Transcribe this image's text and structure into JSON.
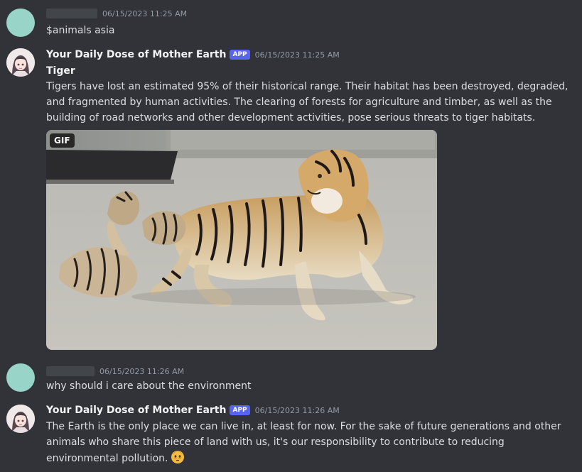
{
  "messages": [
    {
      "timestamp": "06/15/2023 11:25 AM",
      "text": "$animals asia"
    },
    {
      "username": "Your Daily Dose of Mother Earth",
      "badge": "APP",
      "timestamp": "06/15/2023 11:25 AM",
      "title": "Tiger",
      "text": "Tigers have lost an estimated 95% of their historical range. Their habitat has been destroyed, degraded, and fragmented by human activities. The clearing of forests for agriculture and timber, as well as the building of road networks and other development activities, pose serious threats to tiger habitats.",
      "attachment": {
        "badge": "GIF"
      }
    },
    {
      "timestamp": "06/15/2023 11:26 AM",
      "text": "why should i care about the environment"
    },
    {
      "username": "Your Daily Dose of Mother Earth",
      "badge": "APP",
      "timestamp": "06/15/2023 11:26 AM",
      "text": "The Earth is the only place we can live in, at least for now. For the sake of future generations and other animals who share this piece of land with us, it's our responsibility to contribute to reducing environmental pollution.",
      "emoji": "face-with-bags-under-eyes-icon"
    }
  ],
  "colors": {
    "background": "#313338",
    "app_badge": "#5865f2",
    "user_avatar": "#98d4c8"
  }
}
